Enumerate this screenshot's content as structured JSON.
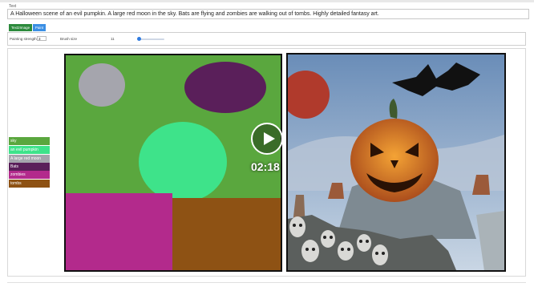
{
  "prompt": {
    "label": "Text",
    "value": "A Halloween scene of an evil pumpkin. A large red moon in the sky. Bats are flying and zombies are walking out of tombs. Highly detailed fantasy art."
  },
  "tabs": [
    {
      "label": "Text2Image",
      "color": "#2c8a3c"
    },
    {
      "label": "Paint",
      "color": "#3b8fe4"
    }
  ],
  "controls": {
    "strength_label": "Painting strength",
    "strength_value": "3",
    "brush_label": "Brush size",
    "brush_value": "11"
  },
  "legend": [
    {
      "label": "sky",
      "color": "#5aa73e"
    },
    {
      "label": "an evil pumpkin",
      "color": "#3ee38a"
    },
    {
      "label": "A large red moon",
      "color": "#a5a5ad"
    },
    {
      "label": "Bats",
      "color": "#5a1f5a"
    },
    {
      "label": "zombies",
      "color": "#b32a8c"
    },
    {
      "label": "tombs",
      "color": "#8e5214"
    }
  ],
  "video": {
    "duration": "02:18",
    "play_icon": "play-icon"
  }
}
